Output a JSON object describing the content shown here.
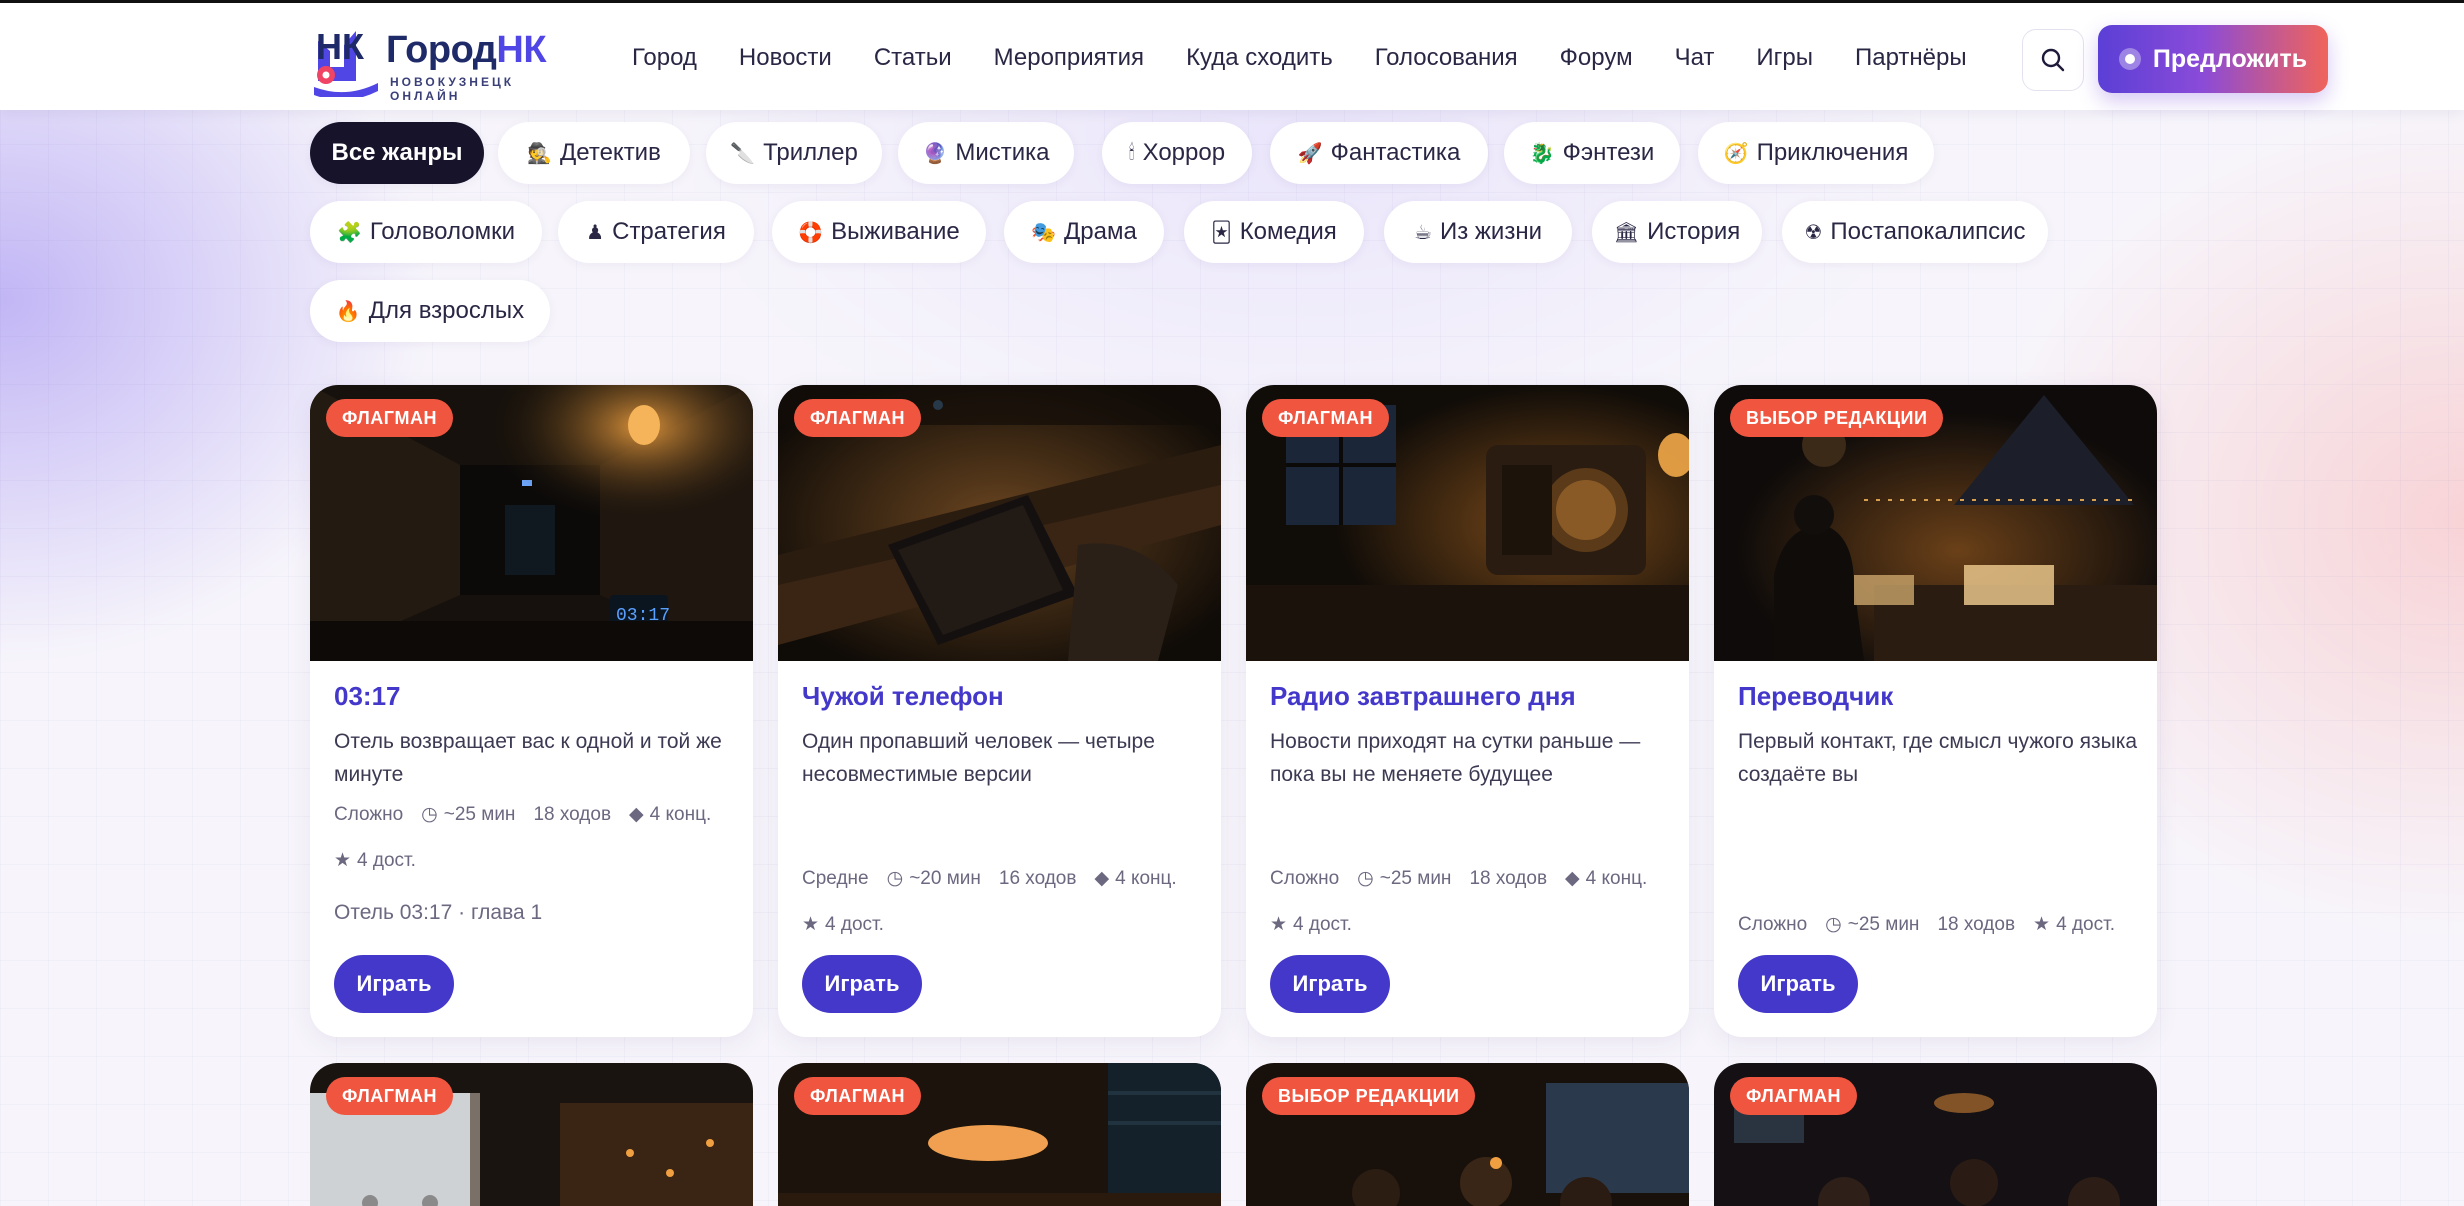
{
  "brand": {
    "name_part1": "Город",
    "name_part2": "НК",
    "subtitle": "НОВОКУЗНЕЦК ОНЛАЙН",
    "mark": "НК"
  },
  "nav": [
    "Город",
    "Новости",
    "Статьи",
    "Мероприятия",
    "Куда сходить",
    "Голосования",
    "Форум",
    "Чат",
    "Игры",
    "Партнёры"
  ],
  "header_actions": {
    "search_icon": "search-icon",
    "suggest_label": "Предложить"
  },
  "genres": [
    {
      "label": "Все жанры",
      "icon": ""
    },
    {
      "label": "Детектив",
      "icon": "🕵"
    },
    {
      "label": "Триллер",
      "icon": "🔪"
    },
    {
      "label": "Мистика",
      "icon": "🔮"
    },
    {
      "label": "Хоррор",
      "icon": "🕯"
    },
    {
      "label": "Фантастика",
      "icon": "🚀"
    },
    {
      "label": "Фэнтези",
      "icon": "🐉"
    },
    {
      "label": "Приключения",
      "icon": "🧭"
    },
    {
      "label": "Головоломки",
      "icon": "🧩"
    },
    {
      "label": "Стратегия",
      "icon": "♟"
    },
    {
      "label": "Выживание",
      "icon": "🛟"
    },
    {
      "label": "Драма",
      "icon": "🎭"
    },
    {
      "label": "Комедия",
      "icon": "🃏"
    },
    {
      "label": "Из жизни",
      "icon": "☕"
    },
    {
      "label": "История",
      "icon": "🏛"
    },
    {
      "label": "Постапокалипсис",
      "icon": "☢"
    },
    {
      "label": "Для взрослых",
      "icon": "🔥"
    }
  ],
  "cards": [
    {
      "badge": "ФЛАГМАН",
      "title": "03:17",
      "description": "Отель возвращает вас к одной и той же минуте",
      "difficulty": "Сложно",
      "time": "~25 мин",
      "moves": "18 ходов",
      "endings": "4 конц.",
      "achievements": "4 дост.",
      "chapter": "Отель 03:17 · глава 1",
      "play_label": "Играть"
    },
    {
      "badge": "ФЛАГМАН",
      "title": "Чужой телефон",
      "description": "Один пропавший человек — четыре несовместимые версии",
      "difficulty": "Средне",
      "time": "~20 мин",
      "moves": "16 ходов",
      "endings": "4 конц.",
      "achievements": "4 дост.",
      "play_label": "Играть"
    },
    {
      "badge": "ФЛАГМАН",
      "title": "Радио завтрашнего дня",
      "description": "Новости приходят на сутки раньше — пока вы не меняете будущее",
      "difficulty": "Сложно",
      "time": "~25 мин",
      "moves": "18 ходов",
      "endings": "4 конц.",
      "achievements": "4 дост.",
      "play_label": "Играть"
    },
    {
      "badge": "ВЫБОР РЕДАКЦИИ",
      "title": "Переводчик",
      "description": "Первый контакт, где смысл чужого языка создаёте вы",
      "difficulty": "Сложно",
      "time": "~25 мин",
      "moves": "18 ходов",
      "achievements": "4 дост.",
      "play_label": "Играть"
    }
  ],
  "second_row_badges": [
    "ФЛАГМАН",
    "ФЛАГМАН",
    "ВЫБОР РЕДАКЦИИ",
    "ФЛАГМАН"
  ],
  "colors": {
    "accent": "#4338ca",
    "badge": "#f0553f",
    "active_chip": "#16132b"
  }
}
